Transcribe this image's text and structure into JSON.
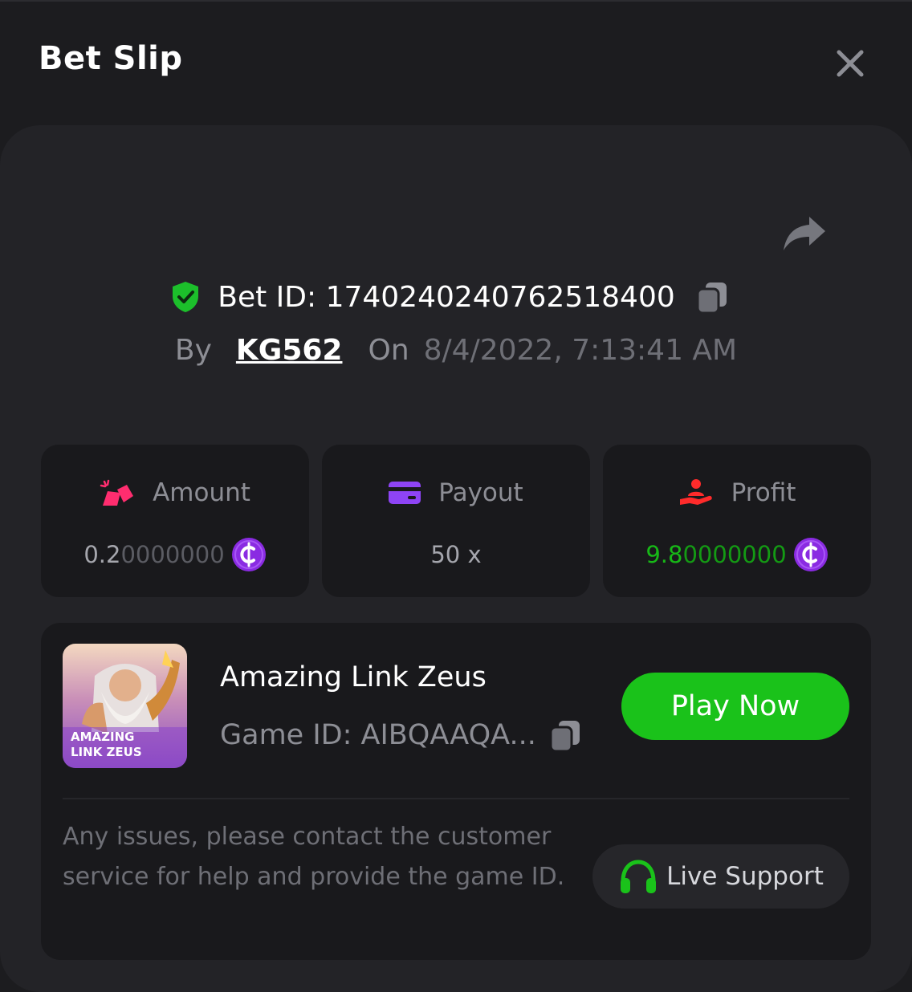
{
  "header": {
    "title": "Bet Slip"
  },
  "bet": {
    "id_label": "Bet ID: 1740240240762518400",
    "by_label": "By",
    "user": "KG562",
    "on_label": "On",
    "datetime": "8/4/2022, 7:13:41 AM"
  },
  "stats": {
    "amount": {
      "label": "Amount",
      "value_main": "0.2",
      "value_trailing": "0000000"
    },
    "payout": {
      "label": "Payout",
      "value": "50 x"
    },
    "profit": {
      "label": "Profit",
      "value_main": "9.8",
      "value_trailing": "0000000"
    }
  },
  "game": {
    "name": "Amazing Link Zeus",
    "id_label": "Game ID: AIBQAAQA...",
    "thumb_line1": "AMAZING",
    "thumb_line2": "LINK ZEUS",
    "play_label": "Play Now"
  },
  "support": {
    "notice": "Any issues, please contact the customer service for help and provide the game ID.",
    "button_label": "Live Support"
  },
  "colors": {
    "background": "#1c1c1f",
    "card": "#232327",
    "tile": "#19191c",
    "accent_green": "#1ac21a",
    "profit_green": "#17b817",
    "coin_purple": "#8a2be2",
    "amount_icon": "#ff2d6f",
    "payout_icon": "#8e44f5",
    "profit_icon": "#ff2b2b"
  },
  "icons": [
    "close-icon",
    "share-icon",
    "shield-check-icon",
    "copy-icon",
    "coins-icon",
    "card-icon",
    "hand-user-icon",
    "coin-icon",
    "headset-icon"
  ]
}
